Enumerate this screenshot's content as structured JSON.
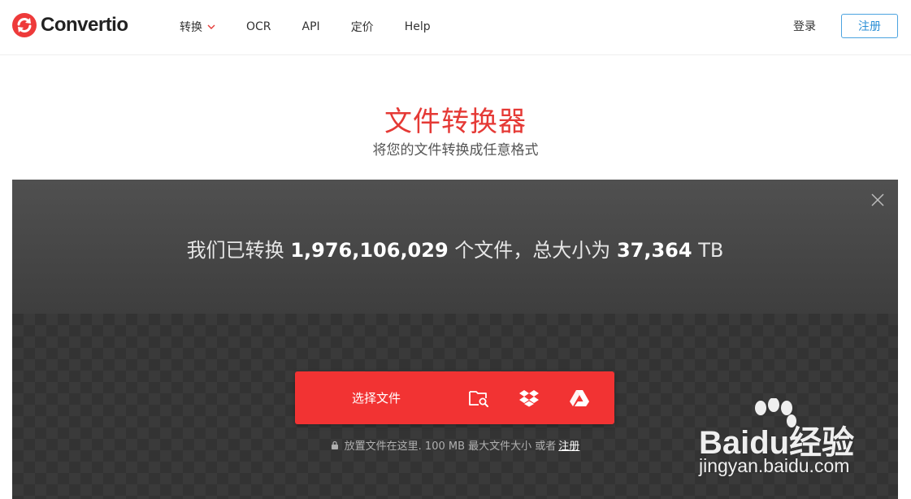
{
  "header": {
    "brand": "Convertio",
    "nav": [
      {
        "label": "转换",
        "has_dropdown": true
      },
      {
        "label": "OCR"
      },
      {
        "label": "API"
      },
      {
        "label": "定价"
      },
      {
        "label": "Help"
      }
    ],
    "login": "登录",
    "register": "注册"
  },
  "hero": {
    "title": "文件转换器",
    "subtitle": "将您的文件转换成任意格式"
  },
  "stats": {
    "prefix": "我们已转换",
    "files_count": "1,976,106,029",
    "middle": "个文件，总大小为",
    "size": "37,364",
    "unit": "TB"
  },
  "upload": {
    "choose_label": "选择文件",
    "sources": [
      "folder-search-icon",
      "dropbox-icon",
      "google-drive-icon"
    ],
    "hint_text": "放置文件在这里. 100 MB 最大文件大小 或者",
    "hint_link": "注册"
  },
  "watermark": {
    "brand_a": "Bai",
    "brand_b": "du",
    "brand_c": "经验",
    "url": "jingyan.baidu.com"
  },
  "colors": {
    "brand_red": "#f23333",
    "title_red": "#e53935",
    "link_blue": "#2b8fd6"
  }
}
